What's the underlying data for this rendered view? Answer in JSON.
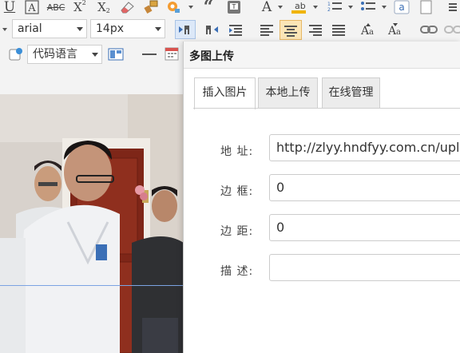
{
  "toolbar": {
    "row1_icons": [
      "underline-icon",
      "font-border-icon",
      "strikethrough-icon",
      "superscript-icon",
      "subscript-icon",
      "eraser-icon",
      "format-painter-icon",
      "auto-format-icon",
      "quote-icon",
      "paste-plain-icon",
      "font-color-icon",
      "back-color-icon",
      "ordered-list-icon",
      "unordered-list-icon",
      "spell-check-icon",
      "page-icon",
      "more-icon"
    ],
    "font_family": "arial",
    "font_size": "14px",
    "code_language": "代码语言",
    "active_align": "center"
  },
  "dialog": {
    "title": "多图上传",
    "tabs": [
      {
        "label": "插入图片",
        "active": true
      },
      {
        "label": "本地上传",
        "active": false
      },
      {
        "label": "在线管理",
        "active": false
      }
    ],
    "fields": {
      "url": {
        "label": "地 址:",
        "value": "http://zlyy.hndfyy.com.cn/uploa"
      },
      "border": {
        "label": "边 框:",
        "value": "0"
      },
      "margin": {
        "label": "边 距:",
        "value": "0"
      },
      "description": {
        "label": "描 述:",
        "value": ""
      }
    }
  }
}
